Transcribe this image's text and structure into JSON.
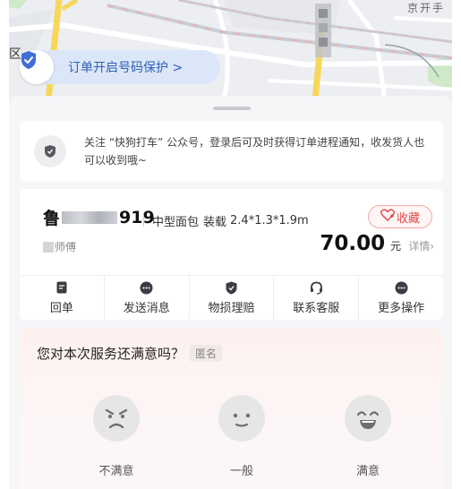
{
  "map": {
    "district_label": "区",
    "corner_label": "京开手",
    "privacy_text": "订单开启号码保护 >"
  },
  "notice": {
    "text": "关注 “快狗打车” 公众号，登录后可及时获得订单进程通知，收发货人也可以收到哦~"
  },
  "order": {
    "plate_prefix": "鲁",
    "plate_suffix": "919",
    "vehicle_type": "中型面包",
    "load_label": "装载",
    "load_size": "2.4*1.3*1.9m",
    "favorite_label": "收藏",
    "driver_suffix": "师傅",
    "price": "70.00",
    "price_unit": "元",
    "detail_label": "详情›"
  },
  "actions": [
    {
      "label": "回单",
      "icon": "receipt-icon"
    },
    {
      "label": "发送消息",
      "icon": "message-icon"
    },
    {
      "label": "物损理赔",
      "icon": "shield-icon"
    },
    {
      "label": "联系客服",
      "icon": "headset-icon"
    },
    {
      "label": "更多操作",
      "icon": "more-icon"
    }
  ],
  "rating": {
    "question": "您对本次服务还满意吗？",
    "anonymous": "匿名",
    "options": [
      {
        "label": "不满意",
        "icon": "angry-face-icon"
      },
      {
        "label": "一般",
        "icon": "neutral-face-icon"
      },
      {
        "label": "满意",
        "icon": "happy-face-icon"
      }
    ]
  },
  "colors": {
    "accent_blue": "#2f5fb8",
    "favorite_red": "#e04848",
    "map_road_yellow": "#f7d75a",
    "rating_bg": "#fdf1f0"
  }
}
